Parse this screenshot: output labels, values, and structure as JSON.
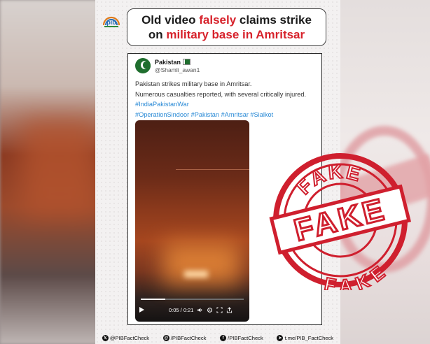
{
  "headline": {
    "line1_plain_a": "Old video ",
    "line1_red": "falsely",
    "line1_plain_b": " claims strike",
    "line2_plain": "on ",
    "line2_red": "military base in Amritsar"
  },
  "tweet": {
    "name": "Pakistan",
    "handle": "@Shamli_awan1",
    "line1": "Pakistan strikes military base in Amritsar.",
    "line2": "Numerous casualties reported, with several critically injured.",
    "tags1": "#IndiaPakistanWar",
    "tags2": "#OperationSindoor #Pakistan #Amritsar #Sialkot"
  },
  "video": {
    "time": "0:05 / 0:21",
    "progress": 0.24
  },
  "stamp": {
    "top": "FAKE",
    "center": "FAKE",
    "bottom": "FAKE"
  },
  "footer": [
    {
      "icon": "x-icon",
      "glyph": "𝕏",
      "label": "@PIBFactCheck"
    },
    {
      "icon": "threads-icon",
      "glyph": "@",
      "label": "/PIBFactCheck"
    },
    {
      "icon": "facebook-icon",
      "glyph": "f",
      "label": "/PIBFactCheck"
    },
    {
      "icon": "telegram-icon",
      "glyph": "➤",
      "label": "t.me/PIB_FactCheck"
    }
  ],
  "colors": {
    "accent_red": "#d7222b",
    "link_blue": "#2a8ad6",
    "stamp_red": "#cf1f2e"
  }
}
